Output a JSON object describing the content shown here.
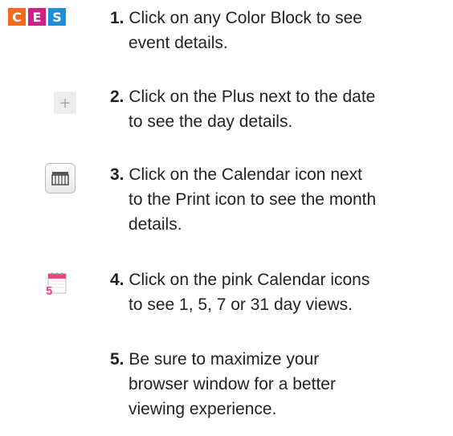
{
  "color_blocks": [
    {
      "letter": "C",
      "color": "#f26a21"
    },
    {
      "letter": "E",
      "color": "#d21f8b"
    },
    {
      "letter": "S",
      "color": "#1e8fd6"
    }
  ],
  "plus_icon": {
    "glyph": "+"
  },
  "pink_calendar": {
    "number": "5",
    "color": "#e8457a"
  },
  "steps": [
    {
      "number": "1.",
      "lines": [
        " Click on any Color Block to see",
        "event details."
      ]
    },
    {
      "number": "2.",
      "lines": [
        " Click on the Plus next to the date",
        "to see the day details."
      ]
    },
    {
      "number": "3.",
      "lines": [
        " Click on the Calendar icon next",
        "to the Print icon to see the month",
        "details."
      ]
    },
    {
      "number": "4.",
      "lines": [
        " Click on the pink Calendar icons",
        "to see 1, 5, 7 or 31 day views."
      ]
    },
    {
      "number": "5.",
      "lines": [
        " Be sure to maximize your",
        "browser window for a better",
        "viewing experience."
      ]
    }
  ]
}
